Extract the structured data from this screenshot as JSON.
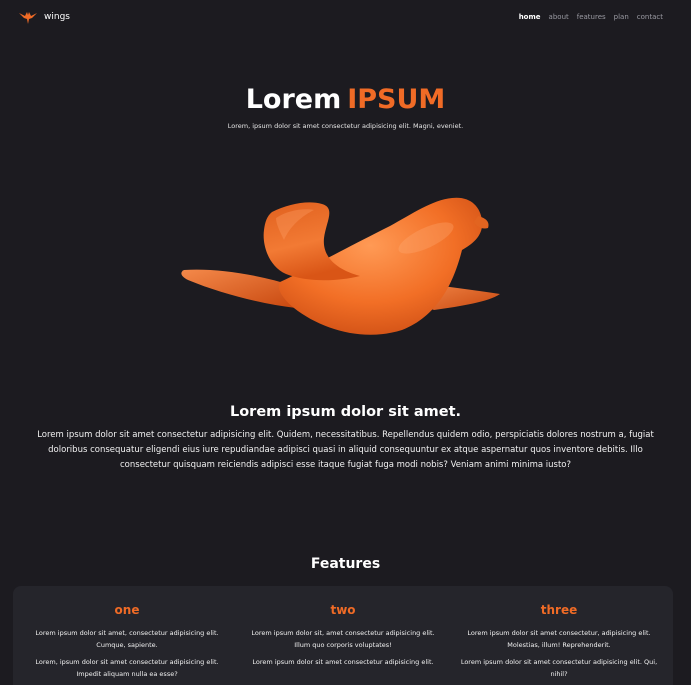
{
  "navbar": {
    "brand": "wings",
    "links": [
      "home",
      "about",
      "features",
      "plan",
      "contact"
    ]
  },
  "hero": {
    "title_main": "Lorem",
    "title_accent": "IPSUM",
    "subtitle": "Lorem, ipsum dolor sit amet consectetur adipisicing elit. Magni, eveniet."
  },
  "about": {
    "title": "Lorem ipsum dolor sit amet.",
    "text": "Lorem ipsum dolor sit amet consectetur adipisicing elit. Quidem, necessitatibus. Repellendus quidem odio, perspiciatis dolores nostrum a, fugiat doloribus consequatur eligendi eius iure repudiandae adipisci quasi in aliquid consequuntur ex atque aspernatur quos inventore debitis. Illo consectetur quisquam reiciendis adipisci esse itaque fugiat fuga modi nobis? Veniam animi minima iusto?"
  },
  "features": {
    "title": "Features",
    "items": [
      {
        "name": "one",
        "p1": "Lorem ipsum dolor sit amet, consectetur adipisicing elit. Cumque, sapiente.",
        "p2": "Lorem, ipsum dolor sit amet consectetur adipisicing elit. Impedit aliquam nulla ea esse?"
      },
      {
        "name": "two",
        "p1": "Lorem ipsum dolor sit, amet consectetur adipisicing elit. Illum quo corporis voluptates!",
        "p2": "Lorem ipsum dolor sit amet consectetur adipisicing elit."
      },
      {
        "name": "three",
        "p1": "Lorem ipsum dolor sit amet consectetur, adipisicing elit. Molestias, illum! Reprehenderit.",
        "p2": "Lorem ipsum dolor sit amet consectetur adipisicing elit. Qui, nihil?"
      }
    ]
  },
  "colors": {
    "background": "#1c1b20",
    "accent": "#f06b26",
    "panel": "#25252b"
  },
  "icons": {
    "logo": "bird-logo-icon",
    "hero": "orange-bird-illustration"
  }
}
